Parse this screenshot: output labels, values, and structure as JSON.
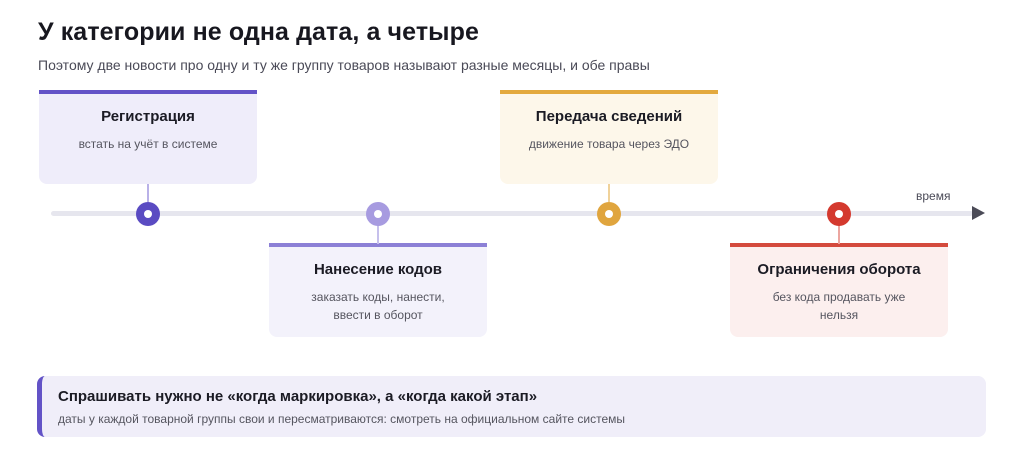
{
  "header": {
    "title": "У категории не одна дата, а четыре",
    "subtitle": "Поэтому две новости про одну и ту же группу товаров называют разные месяцы, и обе правы"
  },
  "timeline": {
    "axis_label": "время",
    "stages": [
      {
        "name": "Регистрация",
        "desc": "встать на учёт в системе",
        "color": "#6353c7"
      },
      {
        "name": "Нанесение кодов",
        "desc": "заказать коды, нанести, ввести в оборот",
        "color": "#8c80d6"
      },
      {
        "name": "Передача сведений",
        "desc": "движение товара через ЭДО",
        "color": "#e3a93e"
      },
      {
        "name": "Ограничения оборота",
        "desc": "без кода продавать уже нельзя",
        "color": "#d44a3d"
      }
    ]
  },
  "callout": {
    "title": "Спрашивать нужно не «когда маркировка», а «когда какой этап»",
    "text": "даты у каждой товарной группы свои и пересматриваются: смотреть на официальном сайте системы"
  }
}
